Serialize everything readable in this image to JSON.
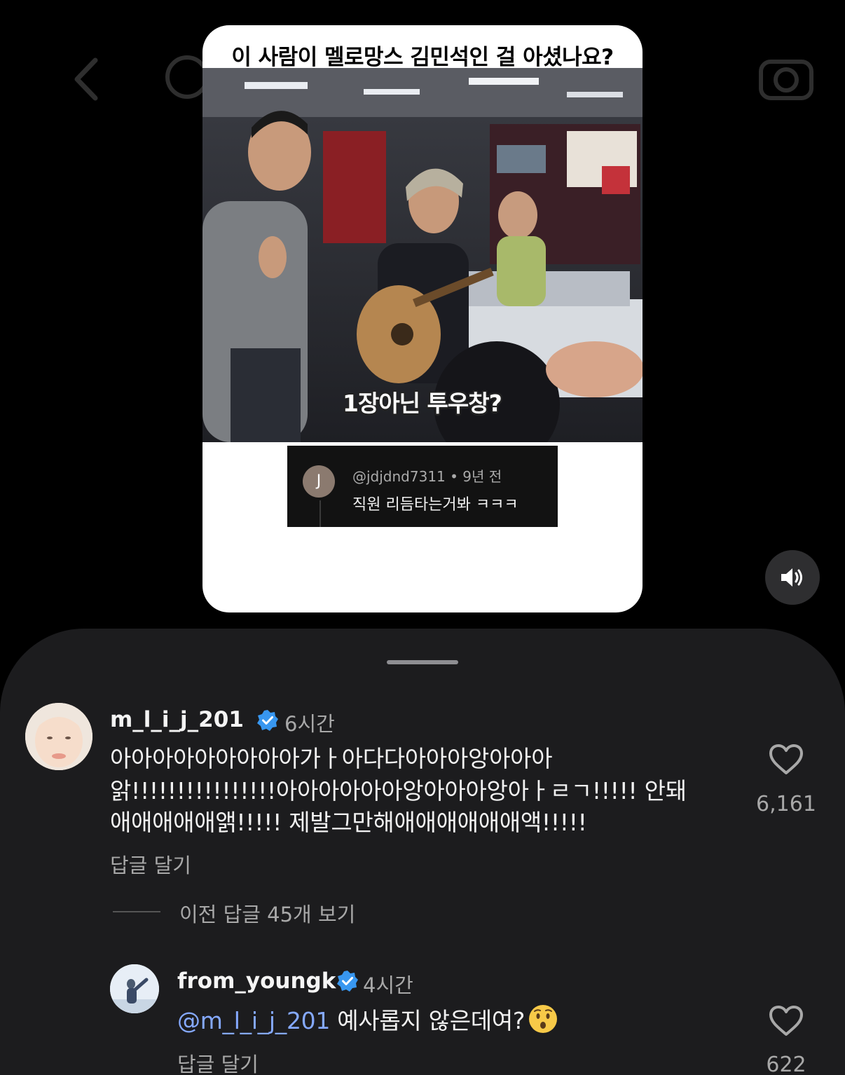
{
  "reel": {
    "title": "이 사람이 멜로망스 김민석인 걸 아셨나요?",
    "video_subtitle": "1장아닌 투우창?",
    "quoted_comment": {
      "avatar_letter": "J",
      "meta": "@jdjdnd7311 • 9년 전",
      "text": "직원 리듬타는거봐 ㅋㅋㅋ"
    }
  },
  "controls": {
    "volume_icon": "speaker-volume-icon"
  },
  "comments": [
    {
      "username": "m_l_i_j_201",
      "verified": true,
      "time": "6시간",
      "text_line1": "아아아아아아아아아가ㅏ아다다아아아앙아아아",
      "text_line2": "앍!!!!!!!!!!!!!!!!아아아아아아앙아아아앙아ㅏㄹㄱ!!!!! 안돼",
      "text_line3": "애애애애애앩!!!!! 제발그만해애애애애애애액!!!!!",
      "reply_label": "답글 달기",
      "likes": "6,161"
    }
  ],
  "view_replies_label": "이전 답글 45개 보기",
  "reply": {
    "username": "from_youngk",
    "verified": true,
    "time": "4시간",
    "mention": "@m_l_i_j_201",
    "text": " 예사롭지 않은데여?",
    "emoji": "hushed-face-emoji",
    "reply_label": "답글 달기",
    "likes": "622"
  },
  "colors": {
    "background": "#000000",
    "sheet": "#1c1c1e",
    "mention": "#85a9ff",
    "verified": "#3897f0",
    "secondary_text": "#a8a8a8"
  }
}
